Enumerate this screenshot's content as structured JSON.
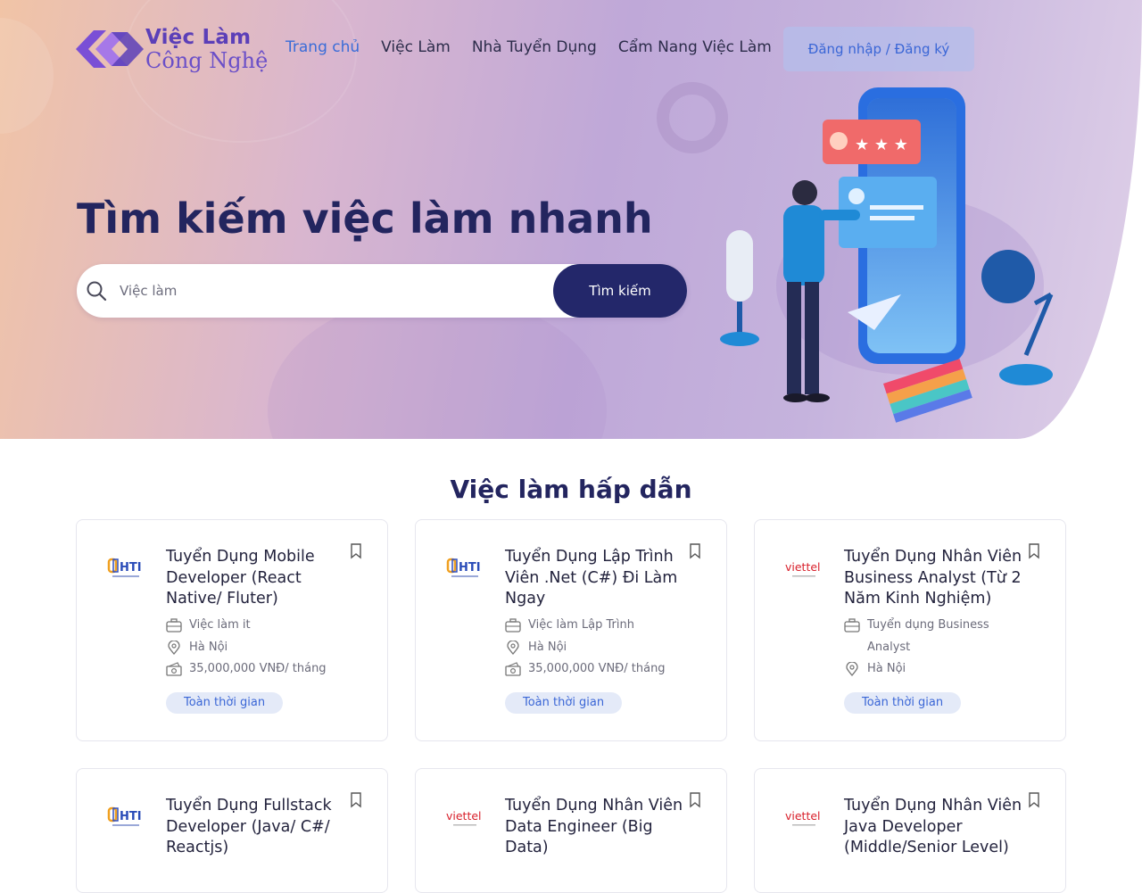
{
  "brand": {
    "line1": "Việc Làm",
    "line2": "Công Nghệ",
    "colors": {
      "primary": "#5b3fb8",
      "accent": "#3a6cd8",
      "dark": "#23255f"
    }
  },
  "nav": {
    "items": [
      {
        "label": "Trang chủ",
        "active": true
      },
      {
        "label": "Việc Làm",
        "active": false
      },
      {
        "label": "Nhà Tuyển Dụng",
        "active": false
      },
      {
        "label": "Cẩm Nang Việc Làm",
        "active": false
      }
    ],
    "login_label": "Đăng nhập / Đăng ký"
  },
  "hero": {
    "title": "Tìm kiếm việc làm nhanh",
    "search": {
      "placeholder": "Việc làm",
      "value": "",
      "button_label": "Tìm kiếm"
    }
  },
  "featured": {
    "title": "Việc làm hấp dẫn",
    "jobs": [
      {
        "company_logo": "HTI",
        "title": "Tuyển Dụng Mobile Developer (React Native/ Fluter)",
        "category": "Việc làm it",
        "location": "Hà Nội",
        "salary": "35,000,000 VNĐ/ tháng",
        "type": "Toàn thời gian"
      },
      {
        "company_logo": "HTI",
        "title": "Tuyển Dụng Lập Trình Viên .Net (C#) Đi Làm Ngay",
        "category": "Việc làm Lập Trình",
        "location": "Hà Nội",
        "salary": "35,000,000 VNĐ/ tháng",
        "type": "Toàn thời gian"
      },
      {
        "company_logo": "viettel",
        "title": "Tuyển Dụng Nhân Viên Business Analyst (Từ 2 Năm Kinh Nghiệm)",
        "category": "Tuyển dụng Business Analyst",
        "location": "Hà Nội",
        "salary": "",
        "type": "Toàn thời gian"
      },
      {
        "company_logo": "HTI",
        "title": "Tuyển Dụng Fullstack Developer (Java/ C#/ Reactjs)",
        "category": "",
        "location": "",
        "salary": "",
        "type": ""
      },
      {
        "company_logo": "viettel",
        "title": "Tuyển Dụng Nhân Viên Data Engineer (Big Data)",
        "category": "",
        "location": "",
        "salary": "",
        "type": ""
      },
      {
        "company_logo": "viettel",
        "title": "Tuyển Dụng Nhân Viên Java Developer (Middle/Senior Level)",
        "category": "",
        "location": "",
        "salary": "",
        "type": ""
      }
    ]
  }
}
